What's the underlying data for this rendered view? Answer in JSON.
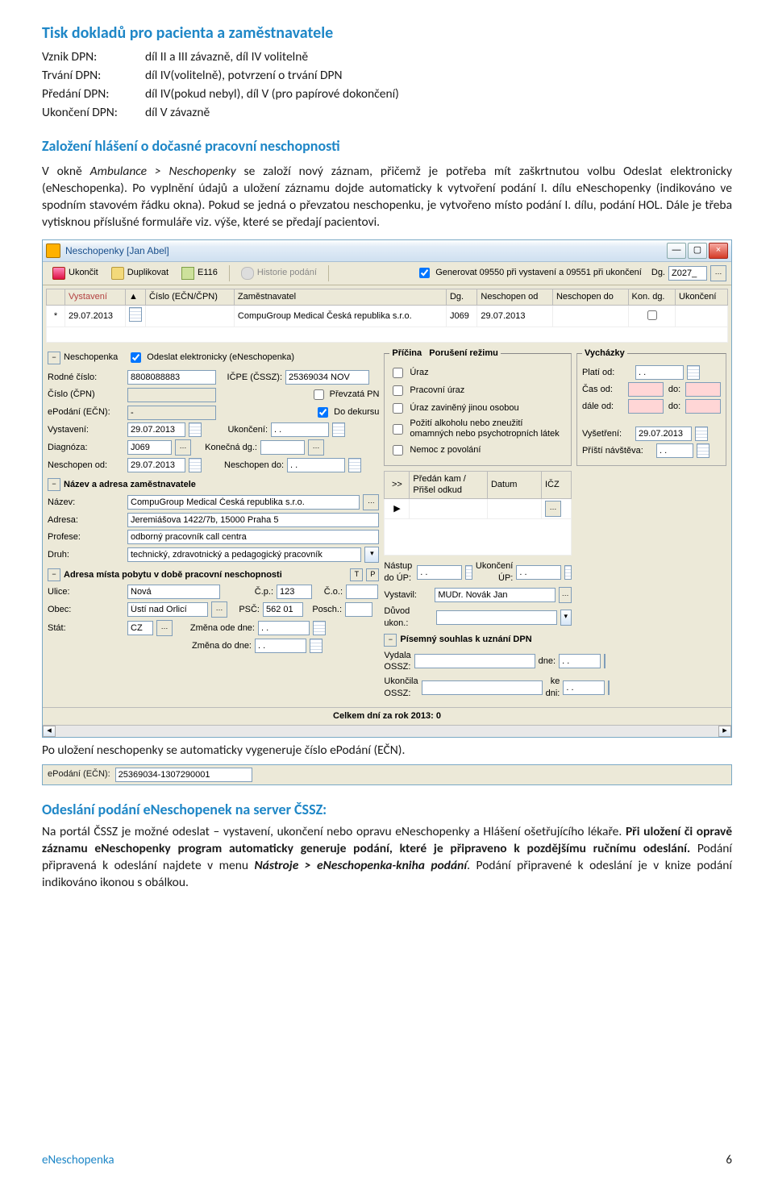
{
  "heading1": "Tisk dokladů pro pacienta a zaměstnavatele",
  "rows": [
    {
      "k": "Vznik DPN:",
      "v": "díl II a III závazně, díl IV volitelně"
    },
    {
      "k": "Trvání DPN:",
      "v": "díl IV(volitelně), potvrzení o trvání DPN"
    },
    {
      "k": "Předání DPN:",
      "v": "díl IV(pokud nebyl), díl V (pro papírové dokončení)"
    },
    {
      "k": "Ukončení DPN:",
      "v": "díl V závazně"
    }
  ],
  "heading2": "Založení hlášení o dočasné pracovní neschopnosti",
  "para1_a": "V okně ",
  "para1_b": "Ambulance > Neschopenky",
  "para1_c": " se založí nový záznam, přičemž je potřeba mít zaškrtnutou volbu Odeslat elektronicky (eNeschopenka). Po vyplnění údajů a uložení záznamu dojde automaticky k vytvoření podání I. dílu eNeschopenky (indikováno ve spodním stavovém řádku okna). Pokud se jedná o převzatou neschopenku, je vytvořeno místo podání I. dílu, podání HOL. Dále je třeba vytisknou příslušné formuláře viz. výše, které se předají pacientovi.",
  "win": {
    "title_pre": "Neschopenky ",
    "title": "[Jan Abel]",
    "tb_close": "Ukončit",
    "tb_dup": "Duplikovat",
    "tb_e116": "E116",
    "tb_hist": "Historie podání",
    "tb_gen": "Generovat 09550 při vystavení a 09551 při ukončení",
    "tb_dg": "Dg.",
    "tb_dg_val": "Z027_",
    "grid_h": [
      "",
      "Vystavení",
      "",
      "Číslo (EČN/ČPN)",
      "Zaměstnavatel",
      "Dg.",
      "Neschopen od",
      "Neschopen do",
      "Kon. dg.",
      "Ukončení"
    ],
    "grid_row": [
      "*",
      "29.07.2013",
      "",
      "",
      "CompuGroup Medical Česká republika s.r.o.",
      "J069",
      "29.07.2013",
      "",
      "",
      ""
    ],
    "leg_nesch": "Neschopenka",
    "chk_odeslat": "Odeslat elektronicky (eNeschopenka)",
    "rc_l": "Rodné číslo:",
    "rc_v": "8808088883",
    "icpe_l": "IČPE (ČSSZ):",
    "icpe_v": "25369034 NOV",
    "cpn_l": "Číslo (ČPN)",
    "prevz": "Převzatá PN",
    "epod_l": "ePodání (EČN):",
    "epod_v": "-",
    "dokurs": "Do dekursu",
    "vyst_l": "Vystavení:",
    "vyst_v": "29.07.2013",
    "ukon_l": "Ukončení:",
    "ukon_v": ". .",
    "diag_l": "Diagnóza:",
    "diag_v": "J069",
    "kdg_l": "Konečná dg.:",
    "kdg_v": "",
    "nod_l": "Neschopen od:",
    "nod_v": "29.07.2013",
    "ndo_l": "Neschopen do:",
    "ndo_v": ". .",
    "zamest_h": "Název a adresa zaměstnavatele",
    "nazev_l": "Název:",
    "nazev_v": "CompuGroup Medical Česká republika s.r.o.",
    "adr_l": "Adresa:",
    "adr_v": "Jeremiášova 1422/7b, 15000 Praha 5",
    "prof_l": "Profese:",
    "prof_v": "odborný pracovník call centra",
    "druh_l": "Druh:",
    "druh_v": "technický, zdravotnický a pedagogický pracovník",
    "pobyt_h": "Adresa místa pobytu v době pracovní neschopnosti",
    "pobyt_T": "T",
    "pobyt_P": "P",
    "ulice_l": "Ulice:",
    "ulice_v": "Nová",
    "cp_l": "Č.p.:",
    "cp_v": "123",
    "co_l": "Č.o.:",
    "obec_l": "Obec:",
    "obec_v": "Ústí nad Orlicí",
    "psc_l": "PSČ:",
    "psc_v": "562 01",
    "posch_l": "Posch.:",
    "stat_l": "Stát:",
    "stat_v": "CZ",
    "zmena_l": "Změna ode dne:",
    "zmena_v": ". .",
    "zmenado_l": "Změna do dne:",
    "zmenado_v": ". .",
    "pricina_h": "Příčina",
    "porus_h": "Porušení režimu",
    "uraz": "Úraz",
    "prac_uraz": "Pracovní úraz",
    "uraz_j": "Úraz zaviněný jinou osobou",
    "pouziti": "Požití alkoholu nebo zneužití omamných nebo psychotropních látek",
    "nemoc": "Nemoc z povolání",
    "vych_h": "Vycházky",
    "plati_l": "Platí od:",
    "plati_v": ". .",
    "casod_l": "Čas od:",
    "casdo_l": "do:",
    "daleod_l": "dále od:",
    "daledo_l": "do:",
    "vysetr_l": "Vyšetření:",
    "vysetr_v": "29.07.2013",
    "pristi_l": "Příští návštěva:",
    "pristi_v": ". .",
    "predan_h": "Předán kam / Přišel odkud",
    "datum_h": "Datum",
    "icz_h": "IČZ",
    "nastup_l": "Nástup do ÚP:",
    "nastup_v": ". .",
    "ukonup_l": "Ukončení ÚP:",
    "ukonup_v": ". .",
    "vystavil_l": "Vystavil:",
    "vystavil_v": "MUDr. Novák Jan",
    "duvod_l": "Důvod ukon.:",
    "pisemny_h": "Písemný souhlas k uznání DPN",
    "vydala_l": "Vydala OSSZ:",
    "dne_l": "dne:",
    "dne_v": ". .",
    "ukossz_l": "Ukončila OSSZ:",
    "kedni_l": "ke dni:",
    "kedni_v": ". .",
    "total": "Celkem dní za rok 2013: 0"
  },
  "para2": "Po uložení neschopenky se automaticky vygeneruje číslo ePodání (EČN).",
  "inset_lbl": "ePodání (EČN):",
  "inset_val": "25369034-1307290001",
  "heading3": "Odeslání podání eNeschopenek na server ČSSZ:",
  "para3_a": "Na portál ČSSZ je možné odeslat – vystavení, ukončení nebo opravu eNeschopenky a Hlášení ošetřujícího lékaře. ",
  "para3_b": "Při uložení či opravě záznamu eNeschopenky program automaticky generuje podání, které je připraveno k pozdějšímu ručnímu odeslání.",
  "para3_c": " Podání připravená k odeslání najdete v menu ",
  "para3_d": "Nástroje > eNeschopenka-kniha podání",
  "para3_e": ". Podání připravené k odeslání je v knize podání indikováno ikonou s obálkou.",
  "footer_name": "eNeschopenka",
  "footer_page": "6"
}
